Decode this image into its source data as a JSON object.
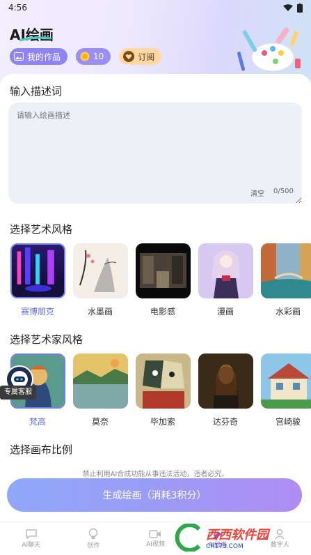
{
  "status_bar": {
    "time": "4:56"
  },
  "header": {
    "title": "AI绘画",
    "chips": {
      "works": "我的作品",
      "points": "10",
      "subscribe": "订阅"
    }
  },
  "prompt": {
    "section_title": "输入描述词",
    "placeholder": "请输入绘画描述",
    "clear_label": "清空",
    "char_count": "0/500"
  },
  "art_styles": {
    "section_title": "选择艺术风格",
    "items": [
      {
        "label": "赛博朋克",
        "selected": true
      },
      {
        "label": "水墨画",
        "selected": false
      },
      {
        "label": "电影感",
        "selected": false
      },
      {
        "label": "漫画",
        "selected": false
      },
      {
        "label": "水彩画",
        "selected": false
      }
    ]
  },
  "artist_styles": {
    "section_title": "选择艺术家风格",
    "items": [
      {
        "label": "梵高",
        "selected": true
      },
      {
        "label": "莫奈",
        "selected": false
      },
      {
        "label": "毕加索",
        "selected": false
      },
      {
        "label": "达芬奇",
        "selected": false
      },
      {
        "label": "宫崎骏",
        "selected": false
      }
    ]
  },
  "canvas": {
    "section_title": "选择画布比例"
  },
  "service": {
    "label": "专属客服"
  },
  "disclaimer": "禁止利用AI合成功能从事违法活动，违者必究。",
  "generate_button": "生成绘画（消耗3积分）",
  "bottom_nav": [
    {
      "label": "AI聊天",
      "icon": "chat-icon",
      "active": false
    },
    {
      "label": "创作",
      "icon": "bulb-icon",
      "active": false
    },
    {
      "label": "AI视频",
      "icon": "video-icon",
      "active": false
    },
    {
      "label": "AI绘画",
      "icon": "paint-icon",
      "active": true
    },
    {
      "label": "数字人",
      "icon": "person-icon",
      "active": false
    }
  ],
  "watermark": {
    "brand": "西西软件园",
    "url": "CR173.COM"
  },
  "colors": {
    "accent": "#5b6ee8",
    "chip_purple": "#8f84f2",
    "subscribe_bg": "#ffd8a6"
  }
}
